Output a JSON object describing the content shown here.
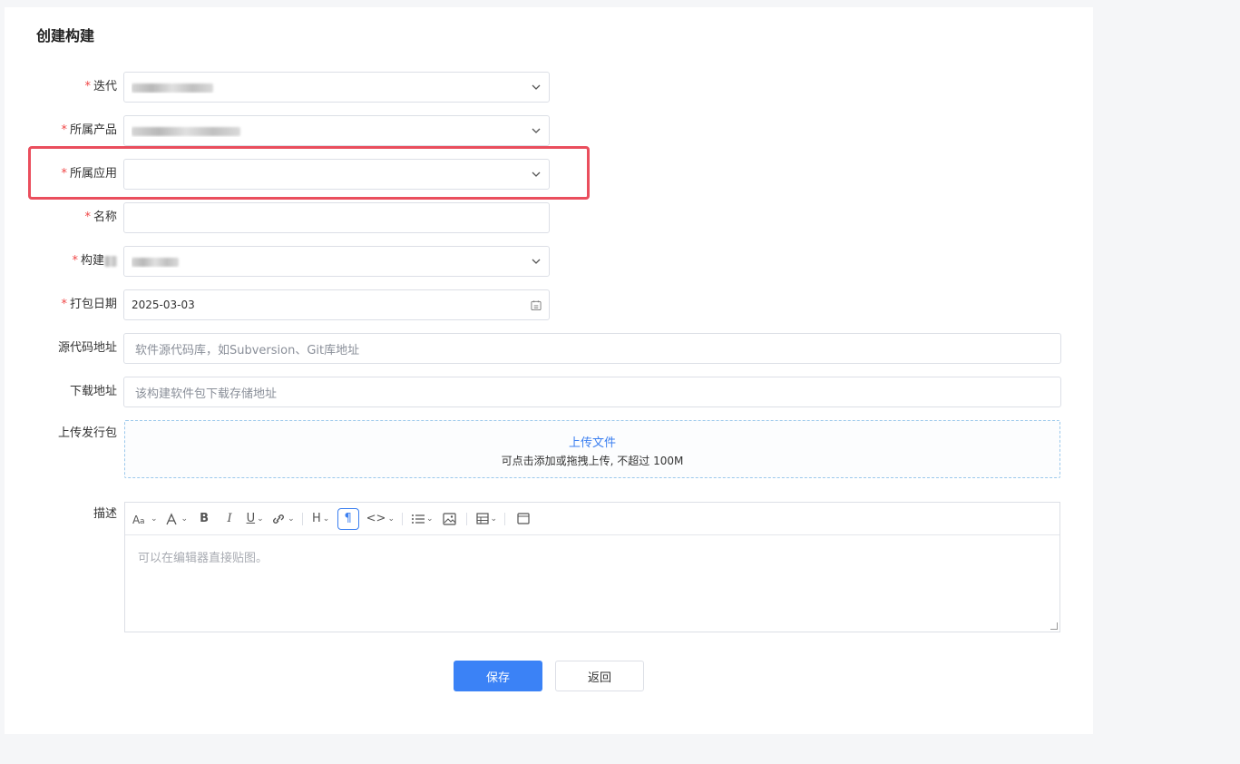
{
  "page": {
    "title": "创建构建"
  },
  "form": {
    "iteration": {
      "label": "迭代",
      "required": true
    },
    "product": {
      "label": "所属产品",
      "required": true
    },
    "application": {
      "label": "所属应用",
      "required": true
    },
    "name": {
      "label": "名称",
      "required": true,
      "value": ""
    },
    "build_type": {
      "label": "构建",
      "required": true
    },
    "pack_date": {
      "label": "打包日期",
      "required": true,
      "value": "2025-03-03"
    },
    "source_url": {
      "label": "源代码地址",
      "placeholder": "软件源代码库，如Subversion、Git库地址"
    },
    "download_url": {
      "label": "下载地址",
      "placeholder": "该构建软件包下载存储地址"
    },
    "upload": {
      "label": "上传发行包",
      "link": "上传文件",
      "hint": "可点击添加或拖拽上传, 不超过 100M"
    },
    "description": {
      "label": "描述",
      "placeholder": "可以在编辑器直接贴图。"
    }
  },
  "toolbar": {
    "heading_label": "H",
    "bold_label": "B",
    "italic_label": "I",
    "underline_label": "U",
    "paragraph_label": "¶",
    "code_label": "<>"
  },
  "buttons": {
    "save": "保存",
    "back": "返回"
  },
  "colors": {
    "accent": "#3b82f6",
    "required": "#f04646",
    "highlight": "#ea4e5d"
  }
}
